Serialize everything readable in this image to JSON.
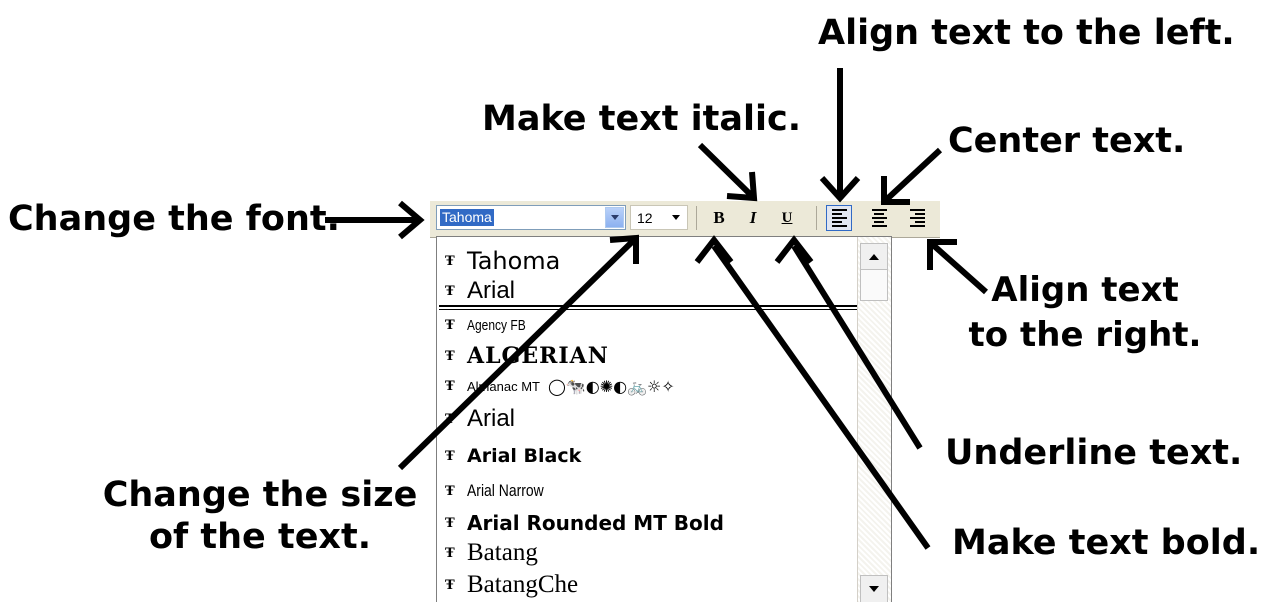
{
  "annotations": {
    "align_left": "Align text to the left.",
    "italic": "Make text italic.",
    "center": "Center text.",
    "change_font": "Change the font.",
    "align_right_1": "Align text",
    "align_right_2": "to the right.",
    "underline": "Underline text.",
    "size_1": "Change the size",
    "size_2": "of the text.",
    "bold": "Make text bold."
  },
  "toolbar": {
    "font_value": "Tahoma",
    "size_value": "12",
    "bold_label": "B",
    "italic_label": "I",
    "underline_label": "U",
    "active_alignment": "left"
  },
  "font_list": {
    "recent": [
      "Tahoma",
      "Arial"
    ],
    "all": [
      "Agency FB",
      "ALGERIAN",
      "Almanac MT",
      "Arial",
      "Arial Black",
      "Arial Narrow",
      "Arial Rounded MT Bold",
      "Batang",
      "BatangChe"
    ],
    "symbol_preview": "◯🐄◐✺◐🚲☼✧"
  },
  "icons": {
    "font_type_icon": "Ŧ",
    "scroll_up": "triangle-up",
    "scroll_down": "triangle-down"
  },
  "colors": {
    "toolbar_bg": "#ece9d8",
    "selection": "#316ac5",
    "pressed_border": "#316ac5"
  }
}
